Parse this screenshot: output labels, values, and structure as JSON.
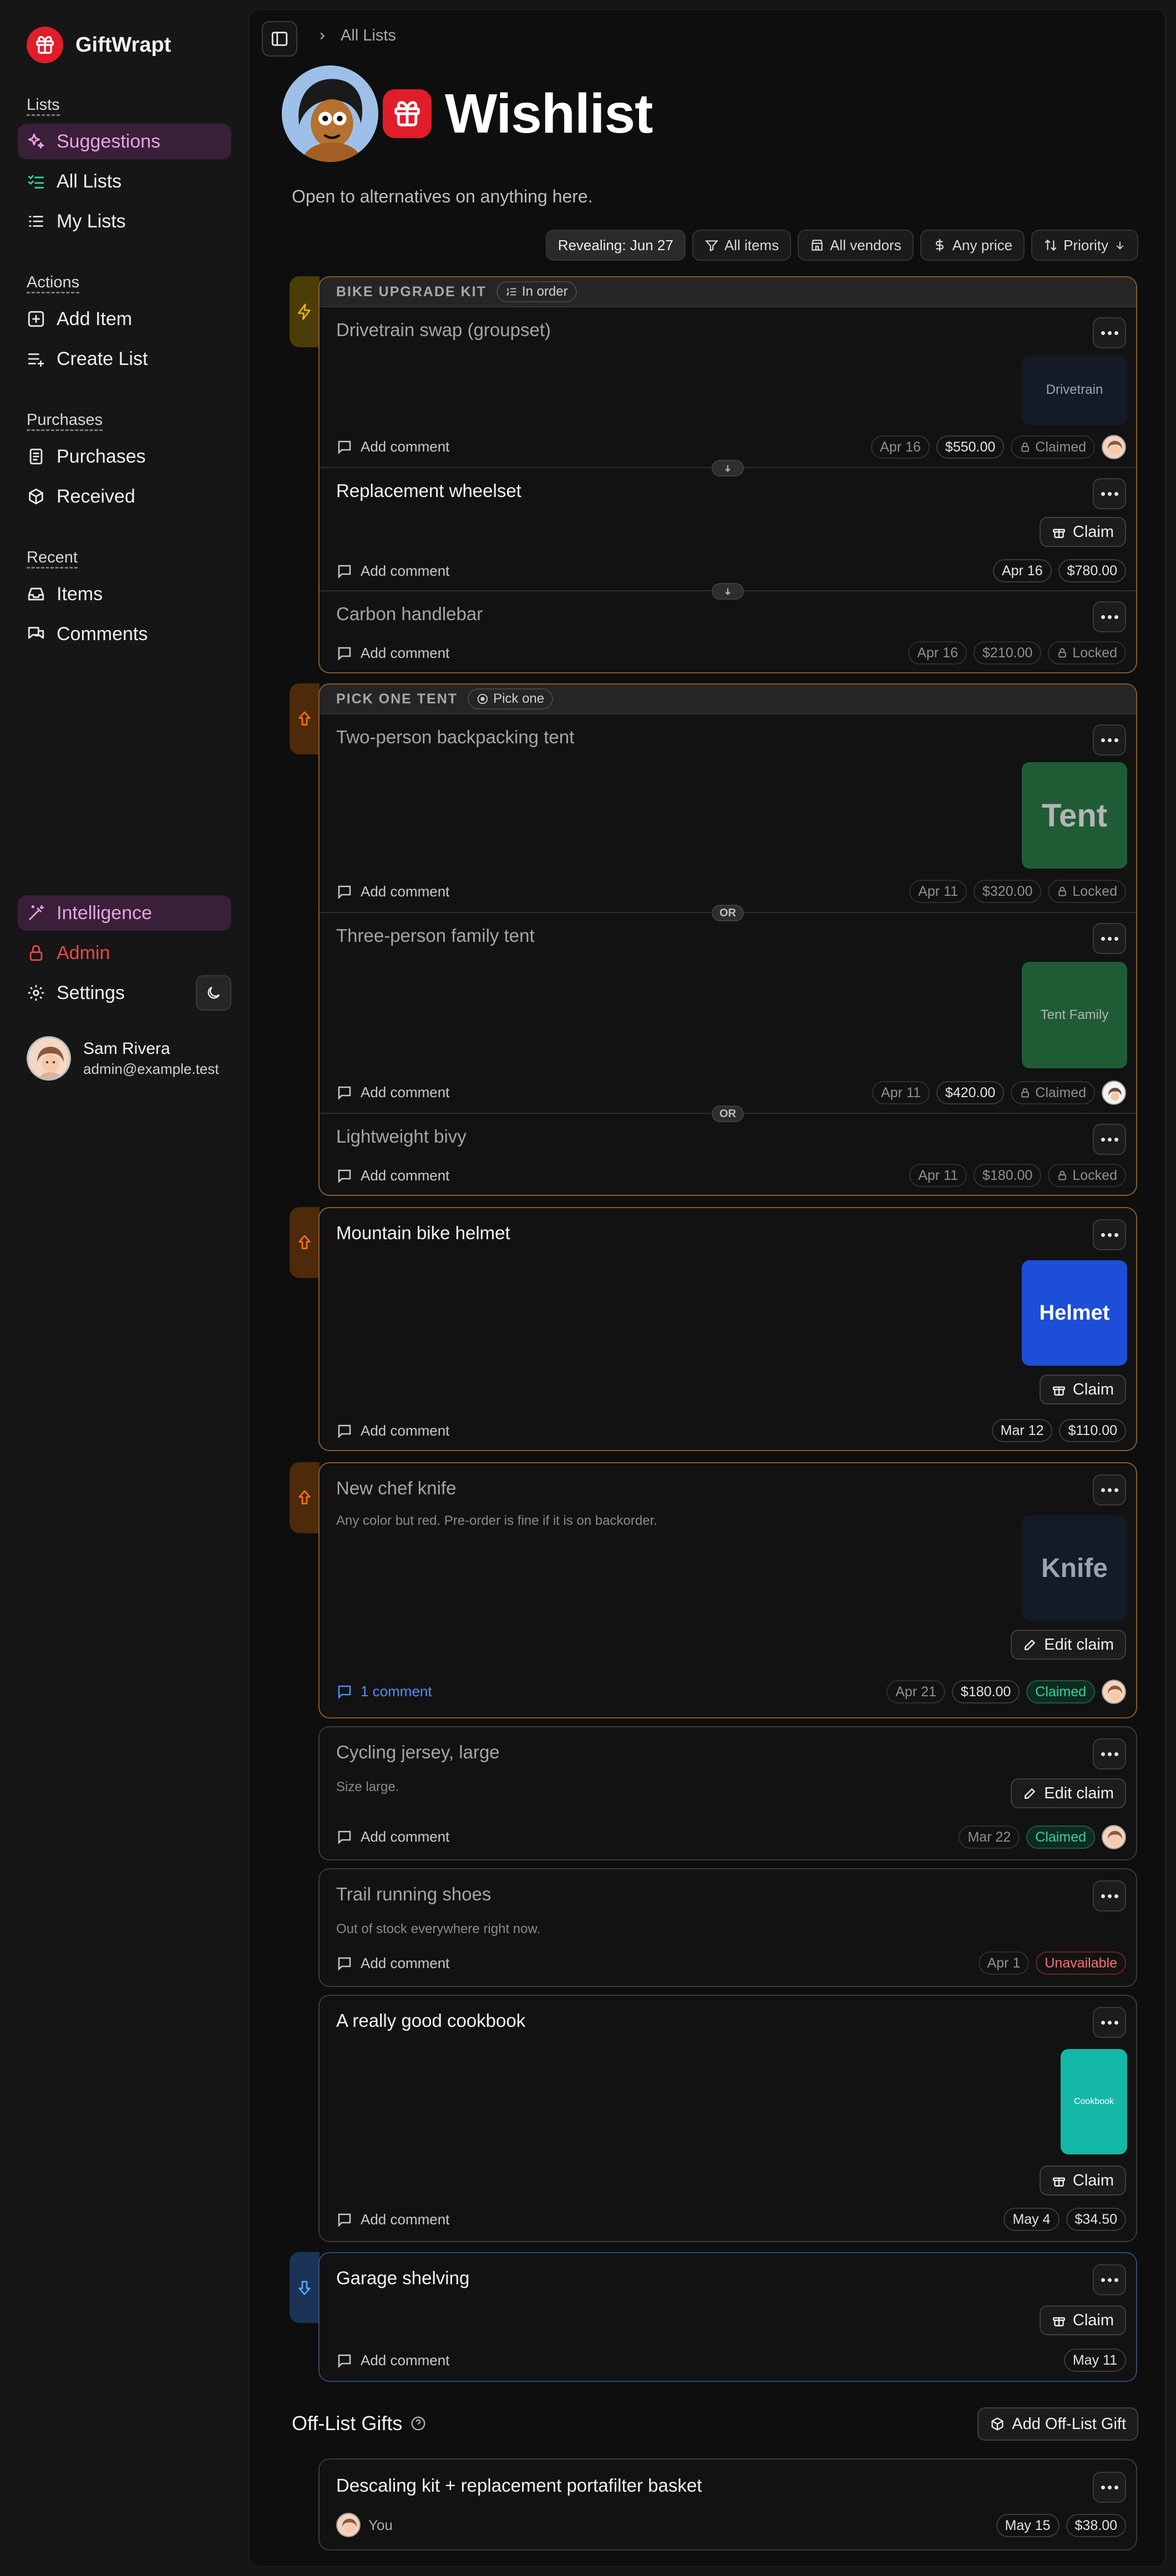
{
  "app": {
    "name": "GiftWrapt"
  },
  "sidebar": {
    "sections": [
      {
        "heading": "Lists",
        "items": [
          {
            "label": "Suggestions",
            "icon": "sparkles-icon"
          },
          {
            "label": "All Lists",
            "icon": "checklist-icon"
          },
          {
            "label": "My Lists",
            "icon": "list-icon"
          }
        ]
      },
      {
        "heading": "Actions",
        "items": [
          {
            "label": "Add Item",
            "icon": "plus-square-icon"
          },
          {
            "label": "Create List",
            "icon": "list-plus-icon"
          }
        ]
      },
      {
        "heading": "Purchases",
        "items": [
          {
            "label": "Purchases",
            "icon": "receipt-icon"
          },
          {
            "label": "Received",
            "icon": "package-icon"
          }
        ]
      },
      {
        "heading": "Recent",
        "items": [
          {
            "label": "Items",
            "icon": "inbox-icon"
          },
          {
            "label": "Comments",
            "icon": "comments-icon"
          }
        ]
      }
    ],
    "bottom": {
      "intelligence": "Intelligence",
      "admin": "Admin",
      "settings": "Settings"
    },
    "user": {
      "name": "Sam Rivera",
      "email": "admin@example.test"
    }
  },
  "breadcrumb": {
    "current": "All Lists"
  },
  "list": {
    "title": "Wishlist",
    "subtitle": "Open to alternatives on anything here."
  },
  "filters": {
    "revealing": "Revealing: Jun 27",
    "items": "All items",
    "vendors": "All vendors",
    "price": "Any price",
    "sort": "Priority"
  },
  "groups": {
    "bike": {
      "label": "BIKE UPGRADE KIT",
      "badge": "In order",
      "items": [
        {
          "title": "Drivetrain swap (groupset)",
          "thumb": "Drivetrain",
          "comment": "Add comment",
          "date": "Apr 16",
          "price": "$550.00",
          "status": "Claimed"
        },
        {
          "title": "Replacement wheelset",
          "action": "Claim",
          "comment": "Add comment",
          "date": "Apr 16",
          "price": "$780.00"
        },
        {
          "title": "Carbon handlebar",
          "comment": "Add comment",
          "date": "Apr 16",
          "price": "$210.00",
          "status": "Locked"
        }
      ]
    },
    "tent": {
      "label": "PICK ONE TENT",
      "badge": "Pick one",
      "sep": "OR",
      "items": [
        {
          "title": "Two-person backpacking tent",
          "thumb": "Tent",
          "comment": "Add comment",
          "date": "Apr 11",
          "price": "$320.00",
          "status": "Locked"
        },
        {
          "title": "Three-person family tent",
          "thumb": "Tent Family",
          "comment": "Add comment",
          "date": "Apr 11",
          "price": "$420.00",
          "status": "Claimed"
        },
        {
          "title": "Lightweight bivy",
          "comment": "Add comment",
          "date": "Apr 11",
          "price": "$180.00",
          "status": "Locked"
        }
      ]
    }
  },
  "items": {
    "helmet": {
      "title": "Mountain bike helmet",
      "thumb": "Helmet",
      "action": "Claim",
      "comment": "Add comment",
      "date": "Mar 12",
      "price": "$110.00"
    },
    "knife": {
      "title": "New chef knife",
      "desc": "Any color but red. Pre-order is fine if it is on backorder.",
      "thumb": "Knife",
      "action": "Edit claim",
      "comment": "1 comment",
      "date": "Apr 21",
      "price": "$180.00",
      "status": "Claimed"
    },
    "jersey": {
      "title": "Cycling jersey, large",
      "desc": "Size large.",
      "action": "Edit claim",
      "comment": "Add comment",
      "date": "Mar 22",
      "status": "Claimed"
    },
    "shoes": {
      "title": "Trail running shoes",
      "desc": "Out of stock everywhere right now.",
      "comment": "Add comment",
      "date": "Apr 1",
      "status": "Unavailable"
    },
    "cookbook": {
      "title": "A really good cookbook",
      "thumb": "Cookbook",
      "action": "Claim",
      "comment": "Add comment",
      "date": "May 4",
      "price": "$34.50"
    },
    "shelving": {
      "title": "Garage shelving",
      "action": "Claim",
      "comment": "Add comment",
      "date": "May 11"
    }
  },
  "offlist": {
    "title": "Off-List Gifts",
    "button": "Add Off-List Gift",
    "item": {
      "title": "Descaling kit + replacement portafilter basket",
      "by": "You",
      "date": "May 15",
      "price": "$38.00"
    }
  },
  "colors": {
    "accent": "#e11d2a",
    "suggest": "#e7a3df",
    "claimed": "#34d399",
    "unavailable": "#f87171",
    "link": "#4f8ff7"
  }
}
